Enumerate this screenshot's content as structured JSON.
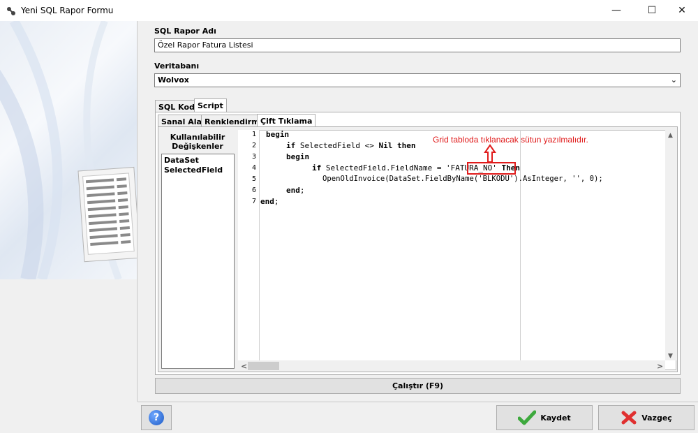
{
  "window": {
    "title": "Yeni SQL Rapor Formu",
    "min": "—",
    "max": "☐",
    "close": "✕"
  },
  "form": {
    "name_label": "SQL Rapor Adı",
    "name_value": "Özel Rapor Fatura Listesi",
    "db_label": "Veritabanı",
    "db_value": "Wolvox",
    "db_arrow": "⌄"
  },
  "tabs": {
    "main": [
      "SQL Kodu",
      "Script"
    ],
    "sub": [
      "Sanal Alan",
      "Renklendirme",
      "Çift Tıklama"
    ]
  },
  "variables": {
    "title": "Kullanılabilir Değişkenler",
    "items": [
      "DataSet",
      "SelectedField"
    ]
  },
  "code": {
    "line_numbers": [
      "1",
      "2",
      "3",
      "4",
      "5",
      "6",
      "7"
    ],
    "l1_kw": "begin",
    "l2_a": "if",
    "l2_b": " SelectedField <> ",
    "l2_c": "Nil",
    "l2_d": " ",
    "l2_e": "then",
    "l3_kw": "begin",
    "l4_a": "if",
    "l4_b": " SelectedField.FieldName = 'FATURA_NO' ",
    "l4_c": "Then",
    "l5": "OpenOldInvoice(DataSet.FieldByName('BLKODU').AsInteger, '', 0);",
    "l6_kw": "end",
    "l6_tail": ";",
    "l7_kw": "end",
    "l7_tail": ";"
  },
  "annotation": {
    "text": "Grid tabloda tıklanacak sütun yazılmalıdır.",
    "color": "#e01b1b"
  },
  "buttons": {
    "run": "Çalıştır (F9)",
    "help": "?",
    "save": "Kaydet",
    "cancel": "Vazgeç"
  },
  "scroll": {
    "up": "▲",
    "down": "▼",
    "left": "<",
    "right": ">"
  }
}
